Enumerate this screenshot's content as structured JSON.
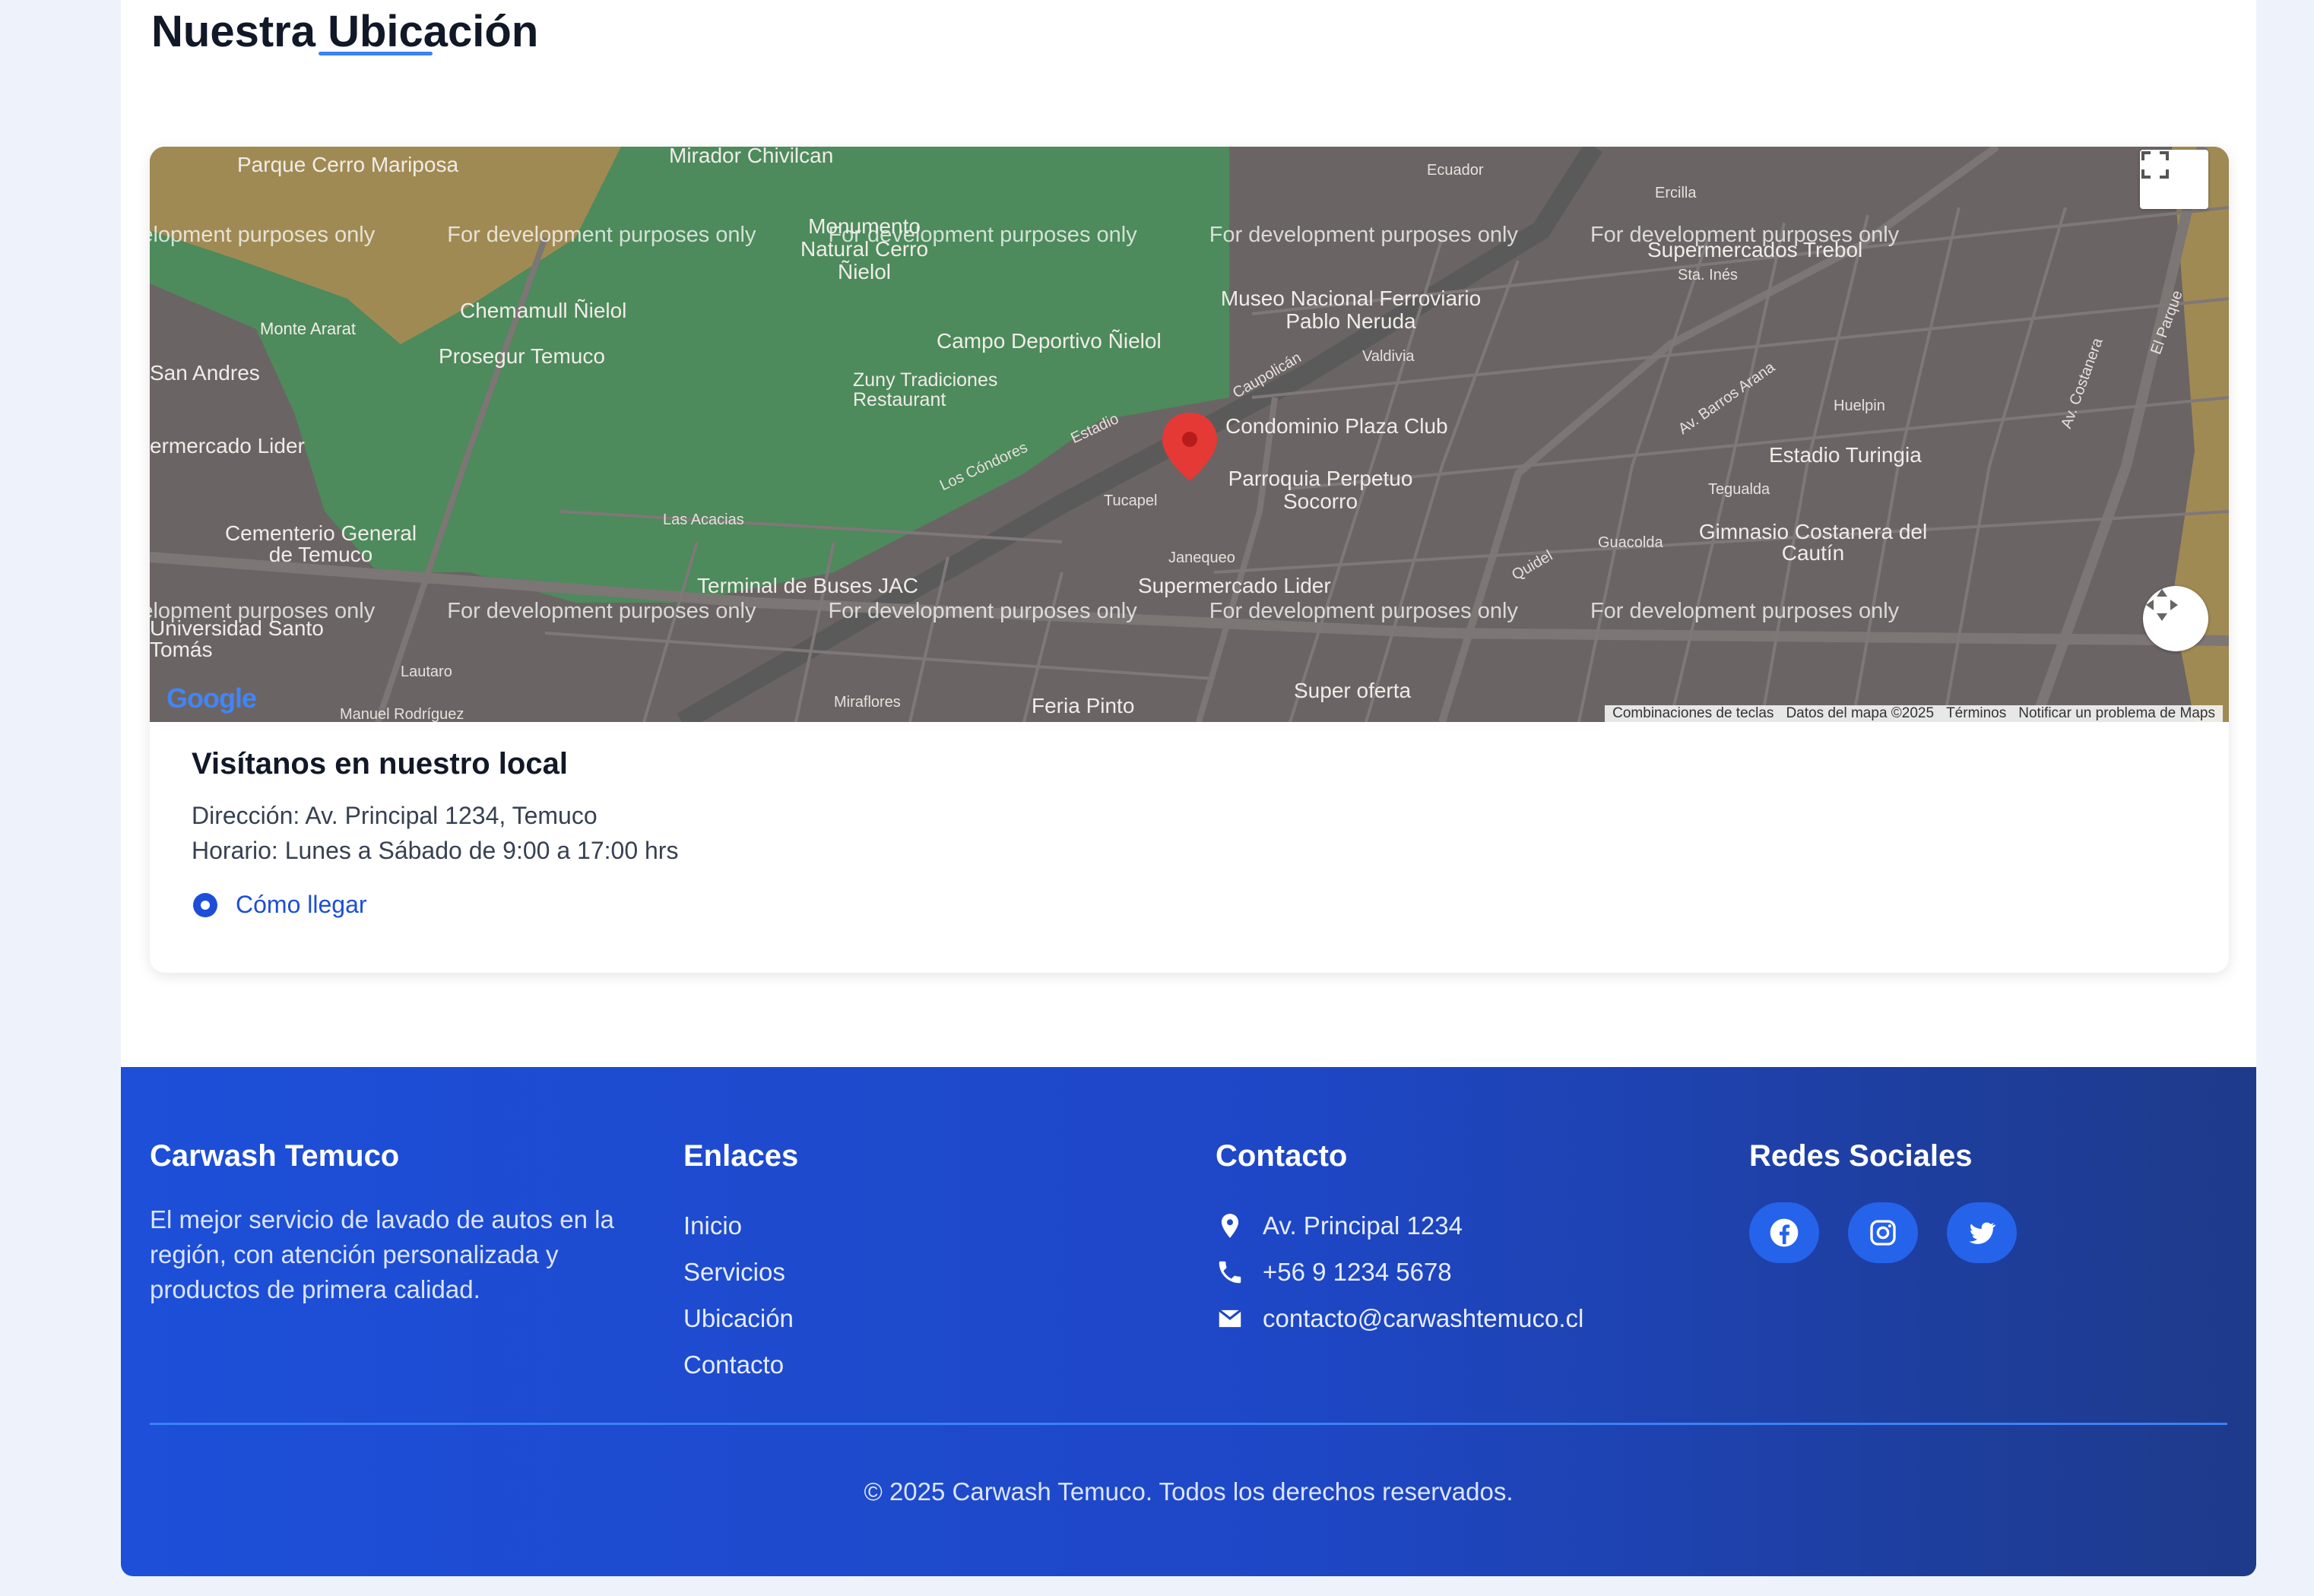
{
  "section": {
    "title": "Nuestra Ubicación"
  },
  "map": {
    "watermark": "For development purposes only",
    "places": [
      "Parque Cerro Mariposa",
      "Mirador Chivilcan",
      "Monumento Natural Cerro Ñielol",
      "Chemamull Ñielol",
      "Monte Ararat",
      "Prosegur Temuco",
      "San Andres",
      "Campo Deportivo Ñielol",
      "Zuny Tradiciones Restaurant",
      "Museo Nacional Ferroviario Pablo Neruda",
      "Supermercados Trebol",
      "Condominio Plaza Club",
      "Parroquia Perpetuo Socorro",
      "Estadio Turingia",
      "Gimnasio Costanera del Cautín",
      "Cementerio General de Temuco",
      "Terminal de Buses JAC",
      "Supermercado Lider",
      "Universidad Santo Tomás",
      "Super oferta",
      "Feria Pinto",
      "ermercado Lider"
    ],
    "streets": [
      "Caupolicán",
      "Las Acacias",
      "Los Cóndores",
      "Estadio",
      "Tucapel",
      "Av. Barros Arana",
      "Valdivia",
      "Av. Costanera",
      "Lautaro",
      "Miraflores",
      "Manuel Rodríguez",
      "Tegualda",
      "Huelpin",
      "Quidel",
      "Guacolda",
      "Janequeo",
      "Sta. Inés",
      "Ercilla",
      "Ecuador",
      "El Parque"
    ],
    "attribution": [
      "Combinaciones de teclas",
      "Datos del mapa ©2025",
      "Términos",
      "Notificar un problema de Maps"
    ],
    "logo": "Google"
  },
  "location": {
    "heading": "Visítanos en nuestro local",
    "address": "Dirección: Av. Principal 1234, Temuco",
    "hours": "Horario: Lunes a Sábado de 9:00 a 17:00 hrs",
    "directions_label": "Cómo llegar"
  },
  "footer": {
    "brand_title": "Carwash Temuco",
    "brand_description": "El mejor servicio de lavado de autos en la región, con atención personalizada y productos de primera calidad.",
    "links_title": "Enlaces",
    "links": [
      "Inicio",
      "Servicios",
      "Ubicación",
      "Contacto"
    ],
    "contact_title": "Contacto",
    "contact": {
      "address": "Av. Principal 1234",
      "phone": "+56 9 1234 5678",
      "email": "contacto@carwashtemuco.cl"
    },
    "social_title": "Redes Sociales",
    "social": [
      "facebook-icon",
      "instagram-icon",
      "twitter-icon"
    ],
    "copyright": "© 2025 Carwash Temuco. Todos los derechos reservados."
  },
  "colors": {
    "primary": "#2563eb",
    "footer_start": "#1d4fd8",
    "footer_end": "#1e3a8a",
    "link": "#1d4ed8"
  }
}
